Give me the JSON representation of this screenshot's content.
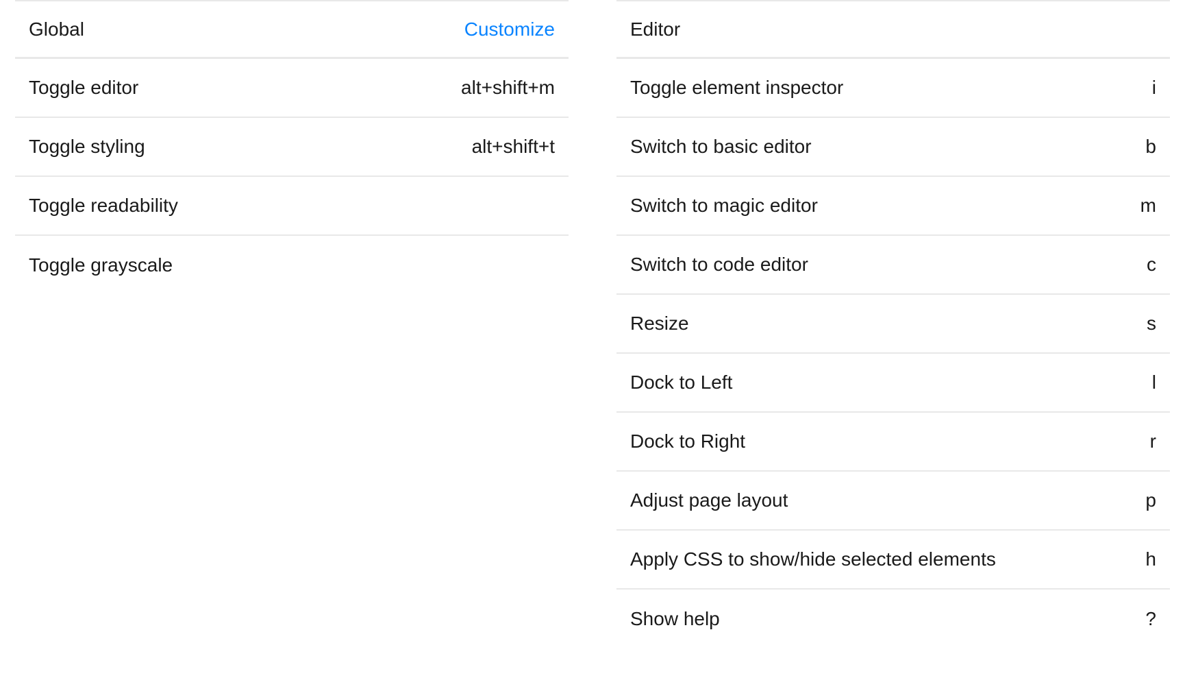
{
  "left": {
    "title": "Global",
    "customize": "Customize",
    "items": [
      {
        "label": "Toggle editor",
        "shortcut": "alt+shift+m"
      },
      {
        "label": "Toggle styling",
        "shortcut": "alt+shift+t"
      },
      {
        "label": "Toggle readability",
        "shortcut": ""
      },
      {
        "label": "Toggle grayscale",
        "shortcut": ""
      }
    ]
  },
  "right": {
    "title": "Editor",
    "items": [
      {
        "label": "Toggle element inspector",
        "shortcut": "i"
      },
      {
        "label": "Switch to basic editor",
        "shortcut": "b"
      },
      {
        "label": "Switch to magic editor",
        "shortcut": "m"
      },
      {
        "label": "Switch to code editor",
        "shortcut": "c"
      },
      {
        "label": "Resize",
        "shortcut": "s"
      },
      {
        "label": "Dock to Left",
        "shortcut": "l"
      },
      {
        "label": "Dock to Right",
        "shortcut": "r"
      },
      {
        "label": "Adjust page layout",
        "shortcut": "p"
      },
      {
        "label": "Apply CSS to show/hide selected elements",
        "shortcut": "h"
      },
      {
        "label": "Show help",
        "shortcut": "?"
      }
    ]
  }
}
